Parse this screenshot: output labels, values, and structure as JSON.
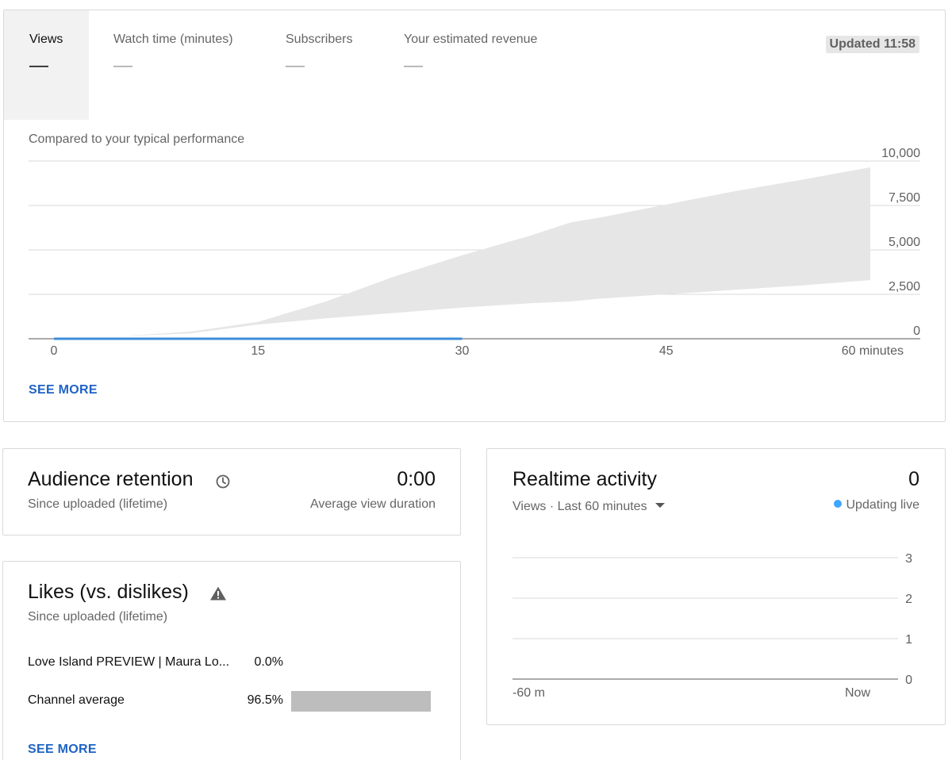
{
  "overview": {
    "tabs": [
      {
        "label": "Views",
        "value": "—",
        "selected": true
      },
      {
        "label": "Watch time (minutes)",
        "value": "—",
        "selected": false
      },
      {
        "label": "Subscribers",
        "value": "—",
        "selected": false
      },
      {
        "label": "Your estimated revenue",
        "value": "—",
        "selected": false
      }
    ],
    "updated": "Updated 11:58",
    "compare_label": "Compared to your typical performance",
    "see_more": "SEE MORE"
  },
  "chart_data": [
    {
      "type": "area",
      "x": [
        0,
        5,
        10,
        15,
        20,
        25,
        30,
        35,
        38,
        40,
        45,
        50,
        55,
        60
      ],
      "series": [
        {
          "values_low": [
            0,
            150,
            300,
            800,
            1150,
            1450,
            1750,
            2000,
            2100,
            2250,
            2500,
            2750,
            3000,
            3300
          ],
          "values_high": [
            0,
            150,
            400,
            950,
            2100,
            3500,
            4700,
            5800,
            6550,
            6800,
            7550,
            8300,
            8950,
            9650
          ],
          "color": "#e6e6e6"
        },
        {
          "values": [
            0,
            0,
            0,
            0,
            0,
            0,
            0
          ],
          "x": [
            0,
            5,
            10,
            15,
            20,
            25,
            30
          ],
          "color": "#3e8edb"
        }
      ],
      "xticks": [
        "0",
        "15",
        "30",
        "45",
        "60 minutes"
      ],
      "xtick_values": [
        0,
        15,
        30,
        45,
        60
      ],
      "yticks": [
        "0",
        "2,500",
        "5,000",
        "7,500",
        "10,000"
      ],
      "ytick_values": [
        0,
        2500,
        5000,
        7500,
        10000
      ],
      "ylim": [
        0,
        10000
      ],
      "xlim": [
        0,
        60
      ],
      "grid": true
    },
    {
      "type": "line",
      "xticks": [
        "-60 m",
        "Now"
      ],
      "yticks": [
        "0",
        "1",
        "2",
        "3"
      ],
      "ytick_values": [
        0,
        1,
        2,
        3
      ],
      "ylim": [
        0,
        3
      ],
      "values": [],
      "grid": true
    }
  ],
  "retention": {
    "title": "Audience retention",
    "icon": "clock-icon",
    "subtitle": "Since uploaded (lifetime)",
    "value": "0:00",
    "value_label": "Average view duration"
  },
  "likes": {
    "title": "Likes (vs. dislikes)",
    "icon": "warning-icon",
    "subtitle": "Since uploaded (lifetime)",
    "rows": [
      {
        "name": "Love Island PREVIEW | Maura Lo...",
        "pct": "0.0%",
        "fraction": 0.0
      },
      {
        "name": "Channel average",
        "pct": "96.5%",
        "fraction": 0.965
      }
    ],
    "see_more": "SEE MORE"
  },
  "realtime": {
    "title": "Realtime activity",
    "value": "0",
    "dropdown": "Views · Last 60 minutes",
    "status": "Updating live",
    "status_color": "#3ea6ff"
  }
}
